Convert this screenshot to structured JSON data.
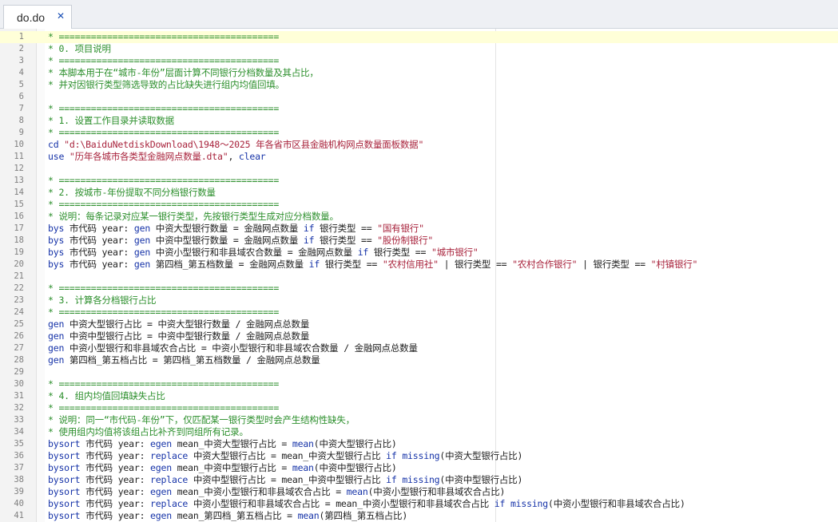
{
  "tabs": [
    {
      "label": "do.do",
      "active": true
    }
  ],
  "colors": {
    "comment": "#2c8f2c",
    "keyword": "#1633a8",
    "string": "#a8233c",
    "text": "#202020",
    "current_line": "#ffffd8"
  },
  "editor": {
    "current_line": 1,
    "lines": [
      {
        "n": "1",
        "tokens": [
          {
            "t": "* =========================================",
            "c": "comment"
          }
        ]
      },
      {
        "n": "2",
        "tokens": [
          {
            "t": "* 0. 项目说明",
            "c": "comment"
          }
        ]
      },
      {
        "n": "3",
        "tokens": [
          {
            "t": "* =========================================",
            "c": "comment"
          }
        ]
      },
      {
        "n": "4",
        "tokens": [
          {
            "t": "* 本脚本用于在“城市-年份”层面计算不同银行分档数量及其占比，",
            "c": "comment"
          }
        ]
      },
      {
        "n": "5",
        "tokens": [
          {
            "t": "* 并对因银行类型筛选导致的占比缺失进行组内均值回填。",
            "c": "comment"
          }
        ]
      },
      {
        "n": "6",
        "tokens": []
      },
      {
        "n": "7",
        "tokens": [
          {
            "t": "* =========================================",
            "c": "comment"
          }
        ]
      },
      {
        "n": "8",
        "tokens": [
          {
            "t": "* 1. 设置工作目录并读取数据",
            "c": "comment"
          }
        ]
      },
      {
        "n": "9",
        "tokens": [
          {
            "t": "* =========================================",
            "c": "comment"
          }
        ]
      },
      {
        "n": "10",
        "tokens": [
          {
            "t": "cd ",
            "c": "keyword"
          },
          {
            "t": "\"d:\\BaiduNetdiskDownload\\1948～2025 年各省市区县金融机构网点数量面板数据\"",
            "c": "string"
          }
        ]
      },
      {
        "n": "11",
        "tokens": [
          {
            "t": "use ",
            "c": "keyword"
          },
          {
            "t": "\"历年各城市各类型金融网点数量.dta\"",
            "c": "string"
          },
          {
            "t": ", ",
            "c": "text"
          },
          {
            "t": "clear",
            "c": "keyword"
          }
        ]
      },
      {
        "n": "12",
        "tokens": []
      },
      {
        "n": "13",
        "tokens": [
          {
            "t": "* =========================================",
            "c": "comment"
          }
        ]
      },
      {
        "n": "14",
        "tokens": [
          {
            "t": "* 2. 按城市-年份提取不同分档银行数量",
            "c": "comment"
          }
        ]
      },
      {
        "n": "15",
        "tokens": [
          {
            "t": "* =========================================",
            "c": "comment"
          }
        ]
      },
      {
        "n": "16",
        "tokens": [
          {
            "t": "* 说明：每条记录对应某一银行类型，先按银行类型生成对应分档数量。",
            "c": "comment"
          }
        ]
      },
      {
        "n": "17",
        "tokens": [
          {
            "t": "bys ",
            "c": "keyword"
          },
          {
            "t": "市代码 year: ",
            "c": "text"
          },
          {
            "t": "gen ",
            "c": "keyword"
          },
          {
            "t": "中资大型银行数量 = 金融网点数量 ",
            "c": "text"
          },
          {
            "t": "if ",
            "c": "keyword"
          },
          {
            "t": "银行类型 == ",
            "c": "text"
          },
          {
            "t": "\"国有银行\"",
            "c": "string"
          }
        ]
      },
      {
        "n": "18",
        "tokens": [
          {
            "t": "bys ",
            "c": "keyword"
          },
          {
            "t": "市代码 year: ",
            "c": "text"
          },
          {
            "t": "gen ",
            "c": "keyword"
          },
          {
            "t": "中资中型银行数量 = 金融网点数量 ",
            "c": "text"
          },
          {
            "t": "if ",
            "c": "keyword"
          },
          {
            "t": "银行类型 == ",
            "c": "text"
          },
          {
            "t": "\"股份制银行\"",
            "c": "string"
          }
        ]
      },
      {
        "n": "19",
        "tokens": [
          {
            "t": "bys ",
            "c": "keyword"
          },
          {
            "t": "市代码 year: ",
            "c": "text"
          },
          {
            "t": "gen ",
            "c": "keyword"
          },
          {
            "t": "中资小型银行和非县域农合数量 = 金融网点数量 ",
            "c": "text"
          },
          {
            "t": "if ",
            "c": "keyword"
          },
          {
            "t": "银行类型 == ",
            "c": "text"
          },
          {
            "t": "\"城市银行\"",
            "c": "string"
          }
        ]
      },
      {
        "n": "20",
        "tokens": [
          {
            "t": "bys ",
            "c": "keyword"
          },
          {
            "t": "市代码 year: ",
            "c": "text"
          },
          {
            "t": "gen ",
            "c": "keyword"
          },
          {
            "t": "第四档_第五档数量 = 金融网点数量 ",
            "c": "text"
          },
          {
            "t": "if ",
            "c": "keyword"
          },
          {
            "t": "银行类型 == ",
            "c": "text"
          },
          {
            "t": "\"农村信用社\"",
            "c": "string"
          },
          {
            "t": " | 银行类型 == ",
            "c": "text"
          },
          {
            "t": "\"农村合作银行\"",
            "c": "string"
          },
          {
            "t": " | 银行类型 == ",
            "c": "text"
          },
          {
            "t": "\"村镇银行\"",
            "c": "string"
          }
        ]
      },
      {
        "n": "21",
        "tokens": []
      },
      {
        "n": "22",
        "tokens": [
          {
            "t": "* =========================================",
            "c": "comment"
          }
        ]
      },
      {
        "n": "23",
        "tokens": [
          {
            "t": "* 3. 计算各分档银行占比",
            "c": "comment"
          }
        ]
      },
      {
        "n": "24",
        "tokens": [
          {
            "t": "* =========================================",
            "c": "comment"
          }
        ]
      },
      {
        "n": "25",
        "tokens": [
          {
            "t": "gen ",
            "c": "keyword"
          },
          {
            "t": "中资大型银行占比 = 中资大型银行数量 / 金融网点总数量",
            "c": "text"
          }
        ]
      },
      {
        "n": "26",
        "tokens": [
          {
            "t": "gen ",
            "c": "keyword"
          },
          {
            "t": "中资中型银行占比 = 中资中型银行数量 / 金融网点总数量",
            "c": "text"
          }
        ]
      },
      {
        "n": "27",
        "tokens": [
          {
            "t": "gen ",
            "c": "keyword"
          },
          {
            "t": "中资小型银行和非县域农合占比 = 中资小型银行和非县域农合数量 / 金融网点总数量",
            "c": "text"
          }
        ]
      },
      {
        "n": "28",
        "tokens": [
          {
            "t": "gen ",
            "c": "keyword"
          },
          {
            "t": "第四档_第五档占比 = 第四档_第五档数量 / 金融网点总数量",
            "c": "text"
          }
        ]
      },
      {
        "n": "29",
        "tokens": []
      },
      {
        "n": "30",
        "tokens": [
          {
            "t": "* =========================================",
            "c": "comment"
          }
        ]
      },
      {
        "n": "31",
        "tokens": [
          {
            "t": "* 4. 组内均值回填缺失占比",
            "c": "comment"
          }
        ]
      },
      {
        "n": "32",
        "tokens": [
          {
            "t": "* =========================================",
            "c": "comment"
          }
        ]
      },
      {
        "n": "33",
        "tokens": [
          {
            "t": "* 说明：同一“市代码-年份”下，仅匹配某一银行类型时会产生结构性缺失，",
            "c": "comment"
          }
        ]
      },
      {
        "n": "34",
        "tokens": [
          {
            "t": "* 使用组内均值将该组占比补齐到同组所有记录。",
            "c": "comment"
          }
        ]
      },
      {
        "n": "35",
        "tokens": [
          {
            "t": "bysort ",
            "c": "keyword"
          },
          {
            "t": "市代码 year: ",
            "c": "text"
          },
          {
            "t": "egen ",
            "c": "keyword"
          },
          {
            "t": "mean_中资大型银行占比 = ",
            "c": "text"
          },
          {
            "t": "mean",
            "c": "keyword"
          },
          {
            "t": "(中资大型银行占比)",
            "c": "text"
          }
        ]
      },
      {
        "n": "36",
        "tokens": [
          {
            "t": "bysort ",
            "c": "keyword"
          },
          {
            "t": "市代码 year: ",
            "c": "text"
          },
          {
            "t": "replace ",
            "c": "keyword"
          },
          {
            "t": "中资大型银行占比 = mean_中资大型银行占比 ",
            "c": "text"
          },
          {
            "t": "if ",
            "c": "keyword"
          },
          {
            "t": "missing",
            "c": "keyword"
          },
          {
            "t": "(中资大型银行占比)",
            "c": "text"
          }
        ]
      },
      {
        "n": "37",
        "tokens": [
          {
            "t": "bysort ",
            "c": "keyword"
          },
          {
            "t": "市代码 year: ",
            "c": "text"
          },
          {
            "t": "egen ",
            "c": "keyword"
          },
          {
            "t": "mean_中资中型银行占比 = ",
            "c": "text"
          },
          {
            "t": "mean",
            "c": "keyword"
          },
          {
            "t": "(中资中型银行占比)",
            "c": "text"
          }
        ]
      },
      {
        "n": "38",
        "tokens": [
          {
            "t": "bysort ",
            "c": "keyword"
          },
          {
            "t": "市代码 year: ",
            "c": "text"
          },
          {
            "t": "replace ",
            "c": "keyword"
          },
          {
            "t": "中资中型银行占比 = mean_中资中型银行占比 ",
            "c": "text"
          },
          {
            "t": "if ",
            "c": "keyword"
          },
          {
            "t": "missing",
            "c": "keyword"
          },
          {
            "t": "(中资中型银行占比)",
            "c": "text"
          }
        ]
      },
      {
        "n": "39",
        "tokens": [
          {
            "t": "bysort ",
            "c": "keyword"
          },
          {
            "t": "市代码 year: ",
            "c": "text"
          },
          {
            "t": "egen ",
            "c": "keyword"
          },
          {
            "t": "mean_中资小型银行和非县域农合占比 = ",
            "c": "text"
          },
          {
            "t": "mean",
            "c": "keyword"
          },
          {
            "t": "(中资小型银行和非县域农合占比)",
            "c": "text"
          }
        ]
      },
      {
        "n": "40",
        "tokens": [
          {
            "t": "bysort ",
            "c": "keyword"
          },
          {
            "t": "市代码 year: ",
            "c": "text"
          },
          {
            "t": "replace ",
            "c": "keyword"
          },
          {
            "t": "中资小型银行和非县域农合占比 = mean_中资小型银行和非县域农合占比 ",
            "c": "text"
          },
          {
            "t": "if ",
            "c": "keyword"
          },
          {
            "t": "missing",
            "c": "keyword"
          },
          {
            "t": "(中资小型银行和非县域农合占比)",
            "c": "text"
          }
        ]
      },
      {
        "n": "41",
        "tokens": [
          {
            "t": "bysort ",
            "c": "keyword"
          },
          {
            "t": "市代码 year: ",
            "c": "text"
          },
          {
            "t": "egen ",
            "c": "keyword"
          },
          {
            "t": "mean_第四档_第五档占比 = ",
            "c": "text"
          },
          {
            "t": "mean",
            "c": "keyword"
          },
          {
            "t": "(第四档_第五档占比)",
            "c": "text"
          }
        ]
      }
    ]
  }
}
